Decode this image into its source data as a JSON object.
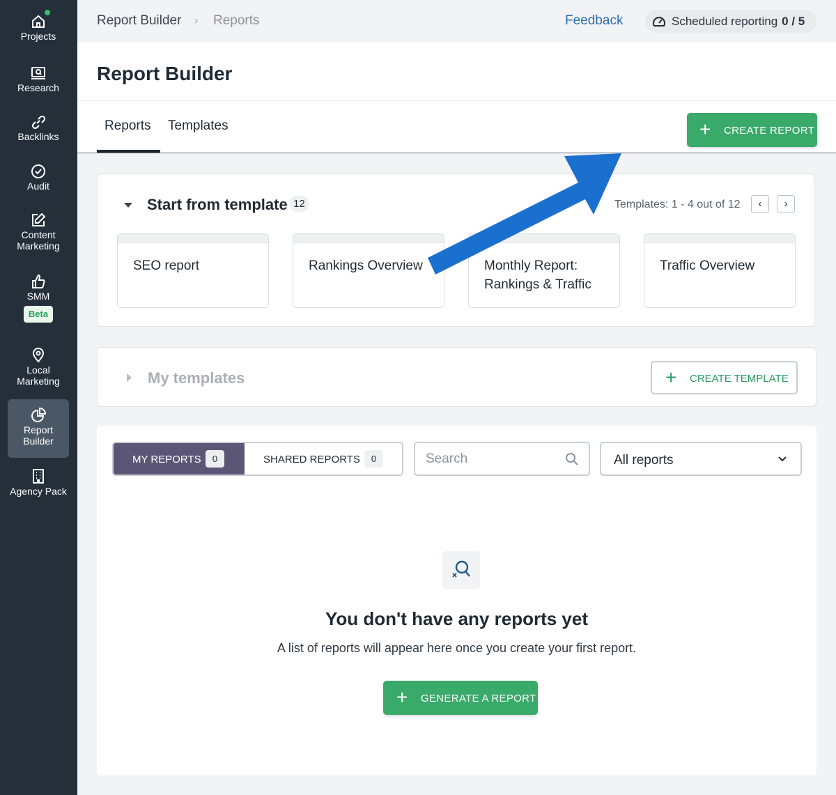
{
  "sidebar": {
    "items": [
      {
        "label": "Projects",
        "icon": "home-icon"
      },
      {
        "label": "Research",
        "icon": "research-icon"
      },
      {
        "label": "Backlinks",
        "icon": "link-icon"
      },
      {
        "label": "Audit",
        "icon": "check-circle-icon"
      },
      {
        "label": "Content Marketing",
        "icon": "edit-icon"
      },
      {
        "label": "SMM",
        "icon": "thumbs-up-icon",
        "badge": "Beta"
      },
      {
        "label": "Local Marketing",
        "icon": "location-pin-icon"
      },
      {
        "label": "Report Builder",
        "icon": "pie-chart-icon",
        "active": true
      },
      {
        "label": "Agency Pack",
        "icon": "building-icon"
      }
    ]
  },
  "topbar": {
    "breadcrumb": [
      "Report Builder",
      "Reports"
    ],
    "feedback": "Feedback",
    "scheduled_label": "Scheduled reporting",
    "scheduled_count": "0 / 5"
  },
  "header": {
    "title": "Report Builder",
    "tabs": [
      "Reports",
      "Templates"
    ],
    "active_tab": "Reports",
    "create_report": "CREATE REPORT"
  },
  "start_template": {
    "title": "Start from template",
    "count": "12",
    "pager_text": "Templates: 1 - 4 out of 12",
    "pager_prev": "‹",
    "pager_next": "›",
    "templates": [
      "SEO report",
      "Rankings Overview",
      "Monthly Report: Rankings & Traffic",
      "Traffic Overview"
    ]
  },
  "my_templates": {
    "title": "My templates",
    "create_template": "CREATE TEMPLATE"
  },
  "reports": {
    "my_reports_label": "MY REPORTS",
    "my_reports_count": "0",
    "shared_reports_label": "SHARED REPORTS",
    "shared_reports_count": "0",
    "search_placeholder": "Search",
    "filter_value": "All reports",
    "empty_title": "You don't have any reports yet",
    "empty_subtitle": "A list of reports will appear here once you create your first report.",
    "generate_button": "GENERATE A REPORT"
  },
  "colors": {
    "sidebar_bg": "#242f3a",
    "accent_green": "#3aaa6b",
    "segment_active": "#5c5676",
    "link_blue": "#2f6fb0",
    "annotation_arrow": "#1a6fcf"
  }
}
